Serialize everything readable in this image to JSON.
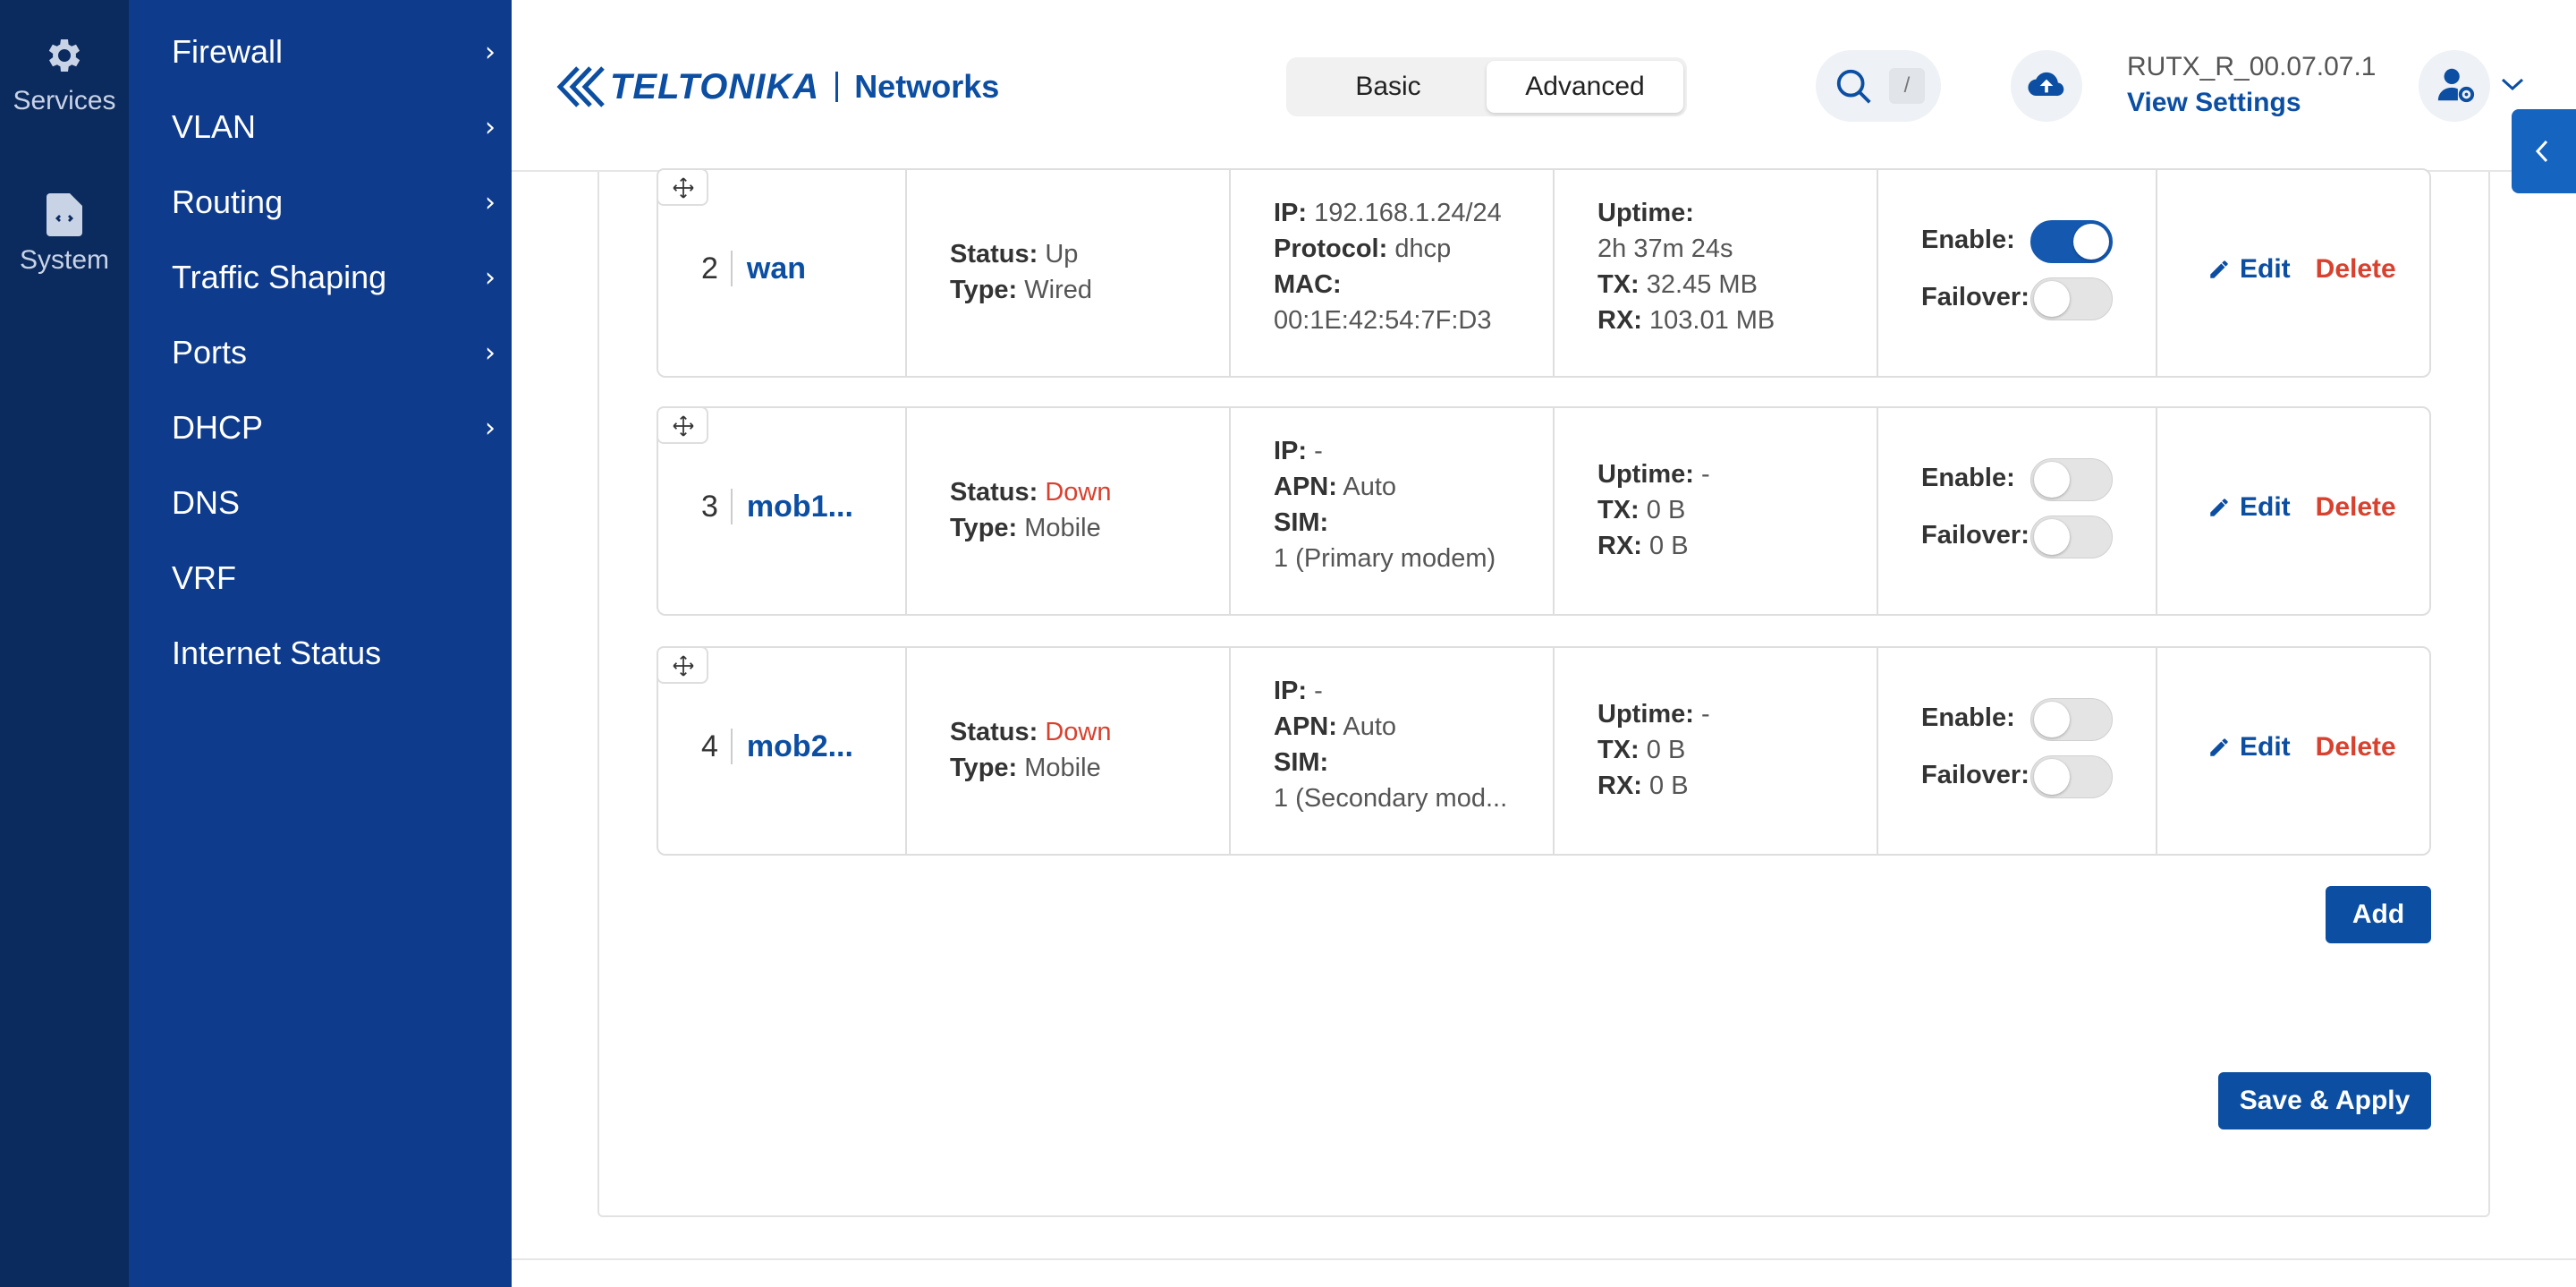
{
  "rail": {
    "services_label": "Services",
    "system_label": "System"
  },
  "sidebar": {
    "items": [
      {
        "label": "Firewall",
        "has_chevron": true
      },
      {
        "label": "VLAN",
        "has_chevron": true
      },
      {
        "label": "Routing",
        "has_chevron": true
      },
      {
        "label": "Traffic Shaping",
        "has_chevron": true
      },
      {
        "label": "Ports",
        "has_chevron": true
      },
      {
        "label": "DHCP",
        "has_chevron": true
      },
      {
        "label": "DNS",
        "has_chevron": false
      },
      {
        "label": "VRF",
        "has_chevron": false
      },
      {
        "label": "Internet Status",
        "has_chevron": false
      }
    ],
    "chevron": "›"
  },
  "header": {
    "logo_brand": "TELTONIKA",
    "logo_sub": "Networks",
    "mode_basic": "Basic",
    "mode_advanced": "Advanced",
    "mode_selected": "Advanced",
    "search_key": "/",
    "firmware": "RUTX_R_00.07.07.1",
    "view_settings": "View Settings"
  },
  "interfaces": [
    {
      "index": "2",
      "name": "wan",
      "status_label": "Status:",
      "status": "Up",
      "status_color": "#555555",
      "type_label": "Type:",
      "type": "Wired",
      "k1": "IP:",
      "v1": "192.168.1.24/24",
      "k2": "Protocol:",
      "v2": "dhcp",
      "k3": "MAC:",
      "v3": "00:1E:42:54:7F:D3",
      "uptime_label": "Uptime:",
      "uptime": "2h 37m 24s",
      "tx_label": "TX:",
      "tx": "32.45 MB",
      "rx_label": "RX:",
      "rx": "103.01 MB",
      "enable_label": "Enable:",
      "enabled": true,
      "failover_label": "Failover:",
      "failover": false
    },
    {
      "index": "3",
      "name": "mob1...",
      "status_label": "Status:",
      "status": "Down",
      "status_color": "#d9412f",
      "type_label": "Type:",
      "type": "Mobile",
      "k1": "IP:",
      "v1": "-",
      "k2": "APN:",
      "v2": "Auto",
      "k3": "SIM:",
      "v3": "1 (Primary modem)",
      "uptime_label": "Uptime:",
      "uptime": "-",
      "tx_label": "TX:",
      "tx": "0 B",
      "rx_label": "RX:",
      "rx": "0 B",
      "enable_label": "Enable:",
      "enabled": false,
      "failover_label": "Failover:",
      "failover": false
    },
    {
      "index": "4",
      "name": "mob2...",
      "status_label": "Status:",
      "status": "Down",
      "status_color": "#d9412f",
      "type_label": "Type:",
      "type": "Mobile",
      "k1": "IP:",
      "v1": "-",
      "k2": "APN:",
      "v2": "Auto",
      "k3": "SIM:",
      "v3": "1 (Secondary mod...",
      "uptime_label": "Uptime:",
      "uptime": "-",
      "tx_label": "TX:",
      "tx": "0 B",
      "rx_label": "RX:",
      "rx": "0 B",
      "enable_label": "Enable:",
      "enabled": false,
      "failover_label": "Failover:",
      "failover": false
    }
  ],
  "actions": {
    "edit": "Edit",
    "delete": "Delete",
    "add": "Add",
    "save_apply": "Save & Apply"
  },
  "colors": {
    "accent": "#0b4ea2",
    "danger": "#d9412f",
    "rail_bg": "#0b2a5e",
    "sidebar_bg": "#0e3b8c"
  }
}
